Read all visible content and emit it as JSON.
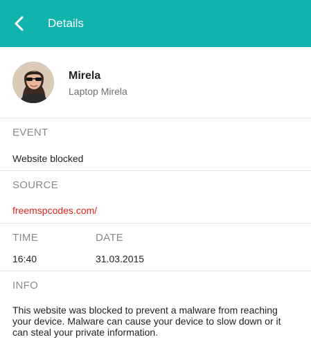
{
  "header": {
    "title": "Details",
    "back_icon": "chevron-left-icon",
    "background_color": "#12b3ad"
  },
  "profile": {
    "name": "Mirela",
    "device": "Laptop Mirela"
  },
  "event": {
    "label": "EVENT",
    "value": "Website blocked"
  },
  "source": {
    "label": "SOURCE",
    "value": "freemspcodes.com/",
    "color": "#e8241f"
  },
  "time": {
    "label": "TIME",
    "value": "16:40"
  },
  "date": {
    "label": "DATE",
    "value": "31.03.2015"
  },
  "info": {
    "label": "INFO",
    "text": "This website was blocked to prevent a malware from reaching your device. Malware can cause your device to slow down or it can steal your private information."
  }
}
